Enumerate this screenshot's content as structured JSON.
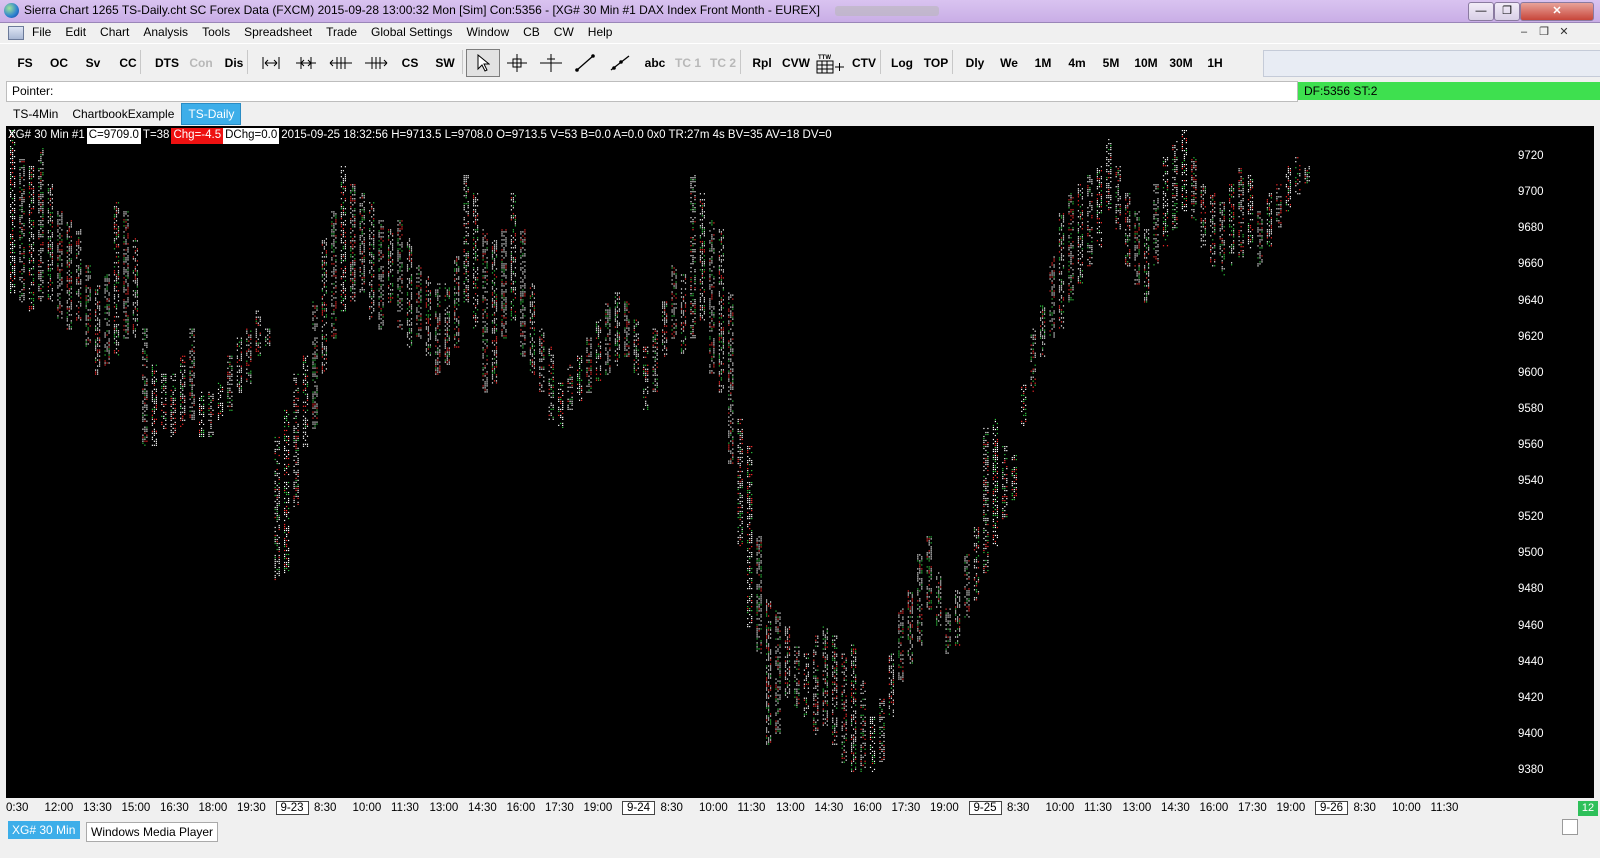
{
  "window": {
    "title": "Sierra Chart 1265 TS-Daily.cht  SC Forex Data (FXCM) 2015-09-28  13:00:32 Mon [Sim]  Con:5356 - [XG#  30 Min   #1  DAX Index Front Month - EUREX]",
    "minimize_label": "—",
    "restore_label": "❐",
    "close_label": "✕"
  },
  "menu": {
    "items": [
      "File",
      "Edit",
      "Chart",
      "Analysis",
      "Tools",
      "Spreadsheet",
      "Trade",
      "Global Settings",
      "Window",
      "CB",
      "CW",
      "Help"
    ],
    "mdi_min": "–",
    "mdi_restore": "❐",
    "mdi_close": "✕"
  },
  "toolbar": {
    "buttons": [
      {
        "label": "FS",
        "icon": "",
        "disabled": false,
        "active": false
      },
      {
        "label": "OC",
        "icon": "",
        "disabled": false,
        "active": false
      },
      {
        "label": "Sv",
        "icon": "",
        "disabled": false,
        "active": false
      },
      {
        "label": "CC",
        "icon": "",
        "disabled": false,
        "active": false
      },
      {
        "label": "DTS",
        "icon": "",
        "disabled": false,
        "active": false
      },
      {
        "label": "Con",
        "icon": "",
        "disabled": true,
        "active": false
      },
      {
        "label": "Dis",
        "icon": "",
        "disabled": false,
        "active": false
      },
      {
        "label": "",
        "icon": "zoom-in-horizontal-icon",
        "disabled": false,
        "active": false
      },
      {
        "label": "",
        "icon": "zoom-out-horizontal-icon",
        "disabled": false,
        "active": false
      },
      {
        "label": "",
        "icon": "scroll-left-icon",
        "disabled": false,
        "active": false
      },
      {
        "label": "",
        "icon": "scroll-right-icon",
        "disabled": false,
        "active": false
      },
      {
        "label": "CS",
        "icon": "",
        "disabled": false,
        "active": false
      },
      {
        "label": "SW",
        "icon": "",
        "disabled": false,
        "active": false
      },
      {
        "label": "",
        "icon": "pointer-arrow-icon",
        "disabled": false,
        "active": true
      },
      {
        "label": "",
        "icon": "crosshair-icon",
        "disabled": false,
        "active": false
      },
      {
        "label": "",
        "icon": "value-tool-icon",
        "disabled": false,
        "active": false
      },
      {
        "label": "",
        "icon": "line-tool-icon",
        "disabled": false,
        "active": false
      },
      {
        "label": "",
        "icon": "ray-tool-icon",
        "disabled": false,
        "active": false
      },
      {
        "label": "abc",
        "icon": "",
        "disabled": false,
        "active": false
      },
      {
        "label": "TC 1",
        "icon": "",
        "disabled": true,
        "active": false
      },
      {
        "label": "TC 2",
        "icon": "",
        "disabled": true,
        "active": false
      },
      {
        "label": "Rpl",
        "icon": "",
        "disabled": false,
        "active": false
      },
      {
        "label": "CVW",
        "icon": "",
        "disabled": false,
        "active": false
      },
      {
        "label": "",
        "icon": "trade-window-grid-icon",
        "disabled": false,
        "active": false
      },
      {
        "label": "CTV",
        "icon": "",
        "disabled": false,
        "active": false
      },
      {
        "label": "Log",
        "icon": "",
        "disabled": false,
        "active": false
      },
      {
        "label": "TOP",
        "icon": "",
        "disabled": false,
        "active": false
      },
      {
        "label": "Dly",
        "icon": "",
        "disabled": false,
        "active": false
      },
      {
        "label": "We",
        "icon": "",
        "disabled": false,
        "active": false
      },
      {
        "label": "1M",
        "icon": "",
        "disabled": false,
        "active": false
      },
      {
        "label": "4m",
        "icon": "",
        "disabled": false,
        "active": false
      },
      {
        "label": "5M",
        "icon": "",
        "disabled": false,
        "active": false
      },
      {
        "label": "10M",
        "icon": "",
        "disabled": false,
        "active": false
      },
      {
        "label": "30M",
        "icon": "",
        "disabled": false,
        "active": false
      },
      {
        "label": "1H",
        "icon": "",
        "disabled": false,
        "active": false
      }
    ]
  },
  "pointer_bar": {
    "label": "Pointer:",
    "status": "DF:5356  ST:2"
  },
  "tabs": [
    {
      "label": "TS-4Min",
      "active": false
    },
    {
      "label": "ChartbookExample",
      "active": false
    },
    {
      "label": "TS-Daily",
      "active": true
    }
  ],
  "info_bar": {
    "symbol": "XG#  30 Min   #1",
    "close": "C=9709.0",
    "trades": "T=38",
    "change": "Chg=-4.5",
    "daily_change": "DChg=0.0",
    "bar_details": "2015-09-25 18:32:56 H=9713.5 L=9708.0 O=9713.5 V=53 B=0.0 A=0.0 0x0 TR:27m 4s BV=35 AV=18 DV=0"
  },
  "colors": {
    "chart_bg": "#000000",
    "up_tick": "#2ecc40",
    "down_tick": "#ff2b2b",
    "neutral_tick": "#ffffff",
    "active_tab": "#3daee9",
    "status_green": "#3ee04f"
  },
  "chart_data": {
    "type": "line",
    "subtype": "tick-cluster-bars",
    "ylim": [
      9375,
      9735
    ],
    "yticks": [
      9380,
      9400,
      9420,
      9440,
      9460,
      9480,
      9500,
      9520,
      9540,
      9560,
      9580,
      9600,
      9620,
      9640,
      9660,
      9680,
      9700,
      9720
    ],
    "xticks": [
      {
        "label": "0:30",
        "date": false
      },
      {
        "label": "12:00",
        "date": false
      },
      {
        "label": "13:30",
        "date": false
      },
      {
        "label": "15:00",
        "date": false
      },
      {
        "label": "16:30",
        "date": false
      },
      {
        "label": "18:00",
        "date": false
      },
      {
        "label": "19:30",
        "date": false
      },
      {
        "label": "9-23",
        "date": true
      },
      {
        "label": "8:30",
        "date": false
      },
      {
        "label": "10:00",
        "date": false
      },
      {
        "label": "11:30",
        "date": false
      },
      {
        "label": "13:00",
        "date": false
      },
      {
        "label": "14:30",
        "date": false
      },
      {
        "label": "16:00",
        "date": false
      },
      {
        "label": "17:30",
        "date": false
      },
      {
        "label": "19:00",
        "date": false
      },
      {
        "label": "9-24",
        "date": true
      },
      {
        "label": "8:30",
        "date": false
      },
      {
        "label": "10:00",
        "date": false
      },
      {
        "label": "11:30",
        "date": false
      },
      {
        "label": "13:00",
        "date": false
      },
      {
        "label": "14:30",
        "date": false
      },
      {
        "label": "16:00",
        "date": false
      },
      {
        "label": "17:30",
        "date": false
      },
      {
        "label": "19:00",
        "date": false
      },
      {
        "label": "9-25",
        "date": true
      },
      {
        "label": "8:30",
        "date": false
      },
      {
        "label": "10:00",
        "date": false
      },
      {
        "label": "11:30",
        "date": false
      },
      {
        "label": "13:00",
        "date": false
      },
      {
        "label": "14:30",
        "date": false
      },
      {
        "label": "16:00",
        "date": false
      },
      {
        "label": "17:30",
        "date": false
      },
      {
        "label": "19:00",
        "date": false
      },
      {
        "label": "9-26",
        "date": true
      },
      {
        "label": "8:30",
        "date": false
      },
      {
        "label": "10:00",
        "date": false
      },
      {
        "label": "11:30",
        "date": false
      }
    ],
    "x_axis_end_label": "12",
    "series": [
      {
        "values": [
          [
            9645,
            9735
          ],
          [
            9640,
            9720
          ],
          [
            9635,
            9715
          ],
          [
            9640,
            9725
          ],
          [
            9640,
            9705
          ],
          [
            9630,
            9690
          ],
          [
            9625,
            9685
          ],
          [
            9630,
            9680
          ],
          [
            9615,
            9660
          ],
          [
            9600,
            9650
          ],
          [
            9605,
            9655
          ],
          [
            9610,
            9695
          ],
          [
            9620,
            9690
          ],
          [
            9620,
            9675
          ],
          [
            9560,
            9625
          ],
          [
            9560,
            9605
          ],
          [
            9570,
            9600
          ],
          [
            9565,
            9600
          ],
          [
            9570,
            9610
          ],
          [
            9575,
            9625
          ],
          [
            9565,
            9590
          ],
          [
            9565,
            9590
          ],
          [
            9575,
            9595
          ],
          [
            9580,
            9610
          ],
          [
            9590,
            9620
          ],
          [
            9595,
            9625
          ],
          [
            9610,
            9635
          ],
          [
            9615,
            9625
          ],
          [
            9485,
            9565
          ],
          [
            9490,
            9580
          ],
          [
            9525,
            9600
          ],
          [
            9560,
            9610
          ],
          [
            9570,
            9640
          ],
          [
            9600,
            9675
          ],
          [
            9620,
            9690
          ],
          [
            9635,
            9715
          ],
          [
            9640,
            9705
          ],
          [
            9645,
            9700
          ],
          [
            9630,
            9695
          ],
          [
            9625,
            9685
          ],
          [
            9640,
            9680
          ],
          [
            9625,
            9685
          ],
          [
            9615,
            9675
          ],
          [
            9620,
            9660
          ],
          [
            9610,
            9655
          ],
          [
            9600,
            9650
          ],
          [
            9605,
            9650
          ],
          [
            9615,
            9665
          ],
          [
            9640,
            9710
          ],
          [
            9625,
            9700
          ],
          [
            9590,
            9680
          ],
          [
            9595,
            9675
          ],
          [
            9620,
            9680
          ],
          [
            9630,
            9700
          ],
          [
            9610,
            9680
          ],
          [
            9600,
            9650
          ],
          [
            9590,
            9625
          ],
          [
            9575,
            9615
          ],
          [
            9570,
            9595
          ],
          [
            9580,
            9605
          ],
          [
            9585,
            9610
          ],
          [
            9590,
            9620
          ],
          [
            9595,
            9630
          ],
          [
            9600,
            9640
          ],
          [
            9605,
            9645
          ],
          [
            9610,
            9640
          ],
          [
            9600,
            9630
          ],
          [
            9580,
            9615
          ],
          [
            9590,
            9625
          ],
          [
            9610,
            9640
          ],
          [
            9620,
            9660
          ],
          [
            9610,
            9655
          ],
          [
            9620,
            9710
          ],
          [
            9630,
            9700
          ],
          [
            9600,
            9685
          ],
          [
            9590,
            9680
          ],
          [
            9550,
            9645
          ],
          [
            9505,
            9575
          ],
          [
            9460,
            9560
          ],
          [
            9445,
            9510
          ],
          [
            9395,
            9475
          ],
          [
            9400,
            9470
          ],
          [
            9420,
            9460
          ],
          [
            9415,
            9450
          ],
          [
            9410,
            9445
          ],
          [
            9400,
            9455
          ],
          [
            9405,
            9460
          ],
          [
            9395,
            9455
          ],
          [
            9385,
            9445
          ],
          [
            9380,
            9450
          ],
          [
            9380,
            9430
          ],
          [
            9380,
            9410
          ],
          [
            9385,
            9420
          ],
          [
            9410,
            9445
          ],
          [
            9430,
            9470
          ],
          [
            9440,
            9480
          ],
          [
            9450,
            9500
          ],
          [
            9470,
            9510
          ],
          [
            9460,
            9490
          ],
          [
            9445,
            9470
          ],
          [
            9450,
            9480
          ],
          [
            9465,
            9500
          ],
          [
            9475,
            9515
          ],
          [
            9490,
            9570
          ],
          [
            9505,
            9575
          ],
          [
            9520,
            9560
          ],
          [
            9530,
            9555
          ],
          [
            9570,
            9595
          ],
          [
            9590,
            9625
          ],
          [
            9610,
            9640
          ],
          [
            9620,
            9665
          ],
          [
            9625,
            9690
          ],
          [
            9640,
            9700
          ],
          [
            9650,
            9705
          ],
          [
            9660,
            9710
          ],
          [
            9670,
            9715
          ],
          [
            9690,
            9730
          ],
          [
            9680,
            9715
          ],
          [
            9660,
            9700
          ],
          [
            9650,
            9690
          ],
          [
            9640,
            9680
          ],
          [
            9660,
            9705
          ],
          [
            9670,
            9720
          ],
          [
            9680,
            9730
          ],
          [
            9690,
            9735
          ],
          [
            9685,
            9720
          ],
          [
            9670,
            9705
          ],
          [
            9660,
            9700
          ],
          [
            9655,
            9695
          ],
          [
            9660,
            9705
          ],
          [
            9665,
            9715
          ],
          [
            9670,
            9710
          ],
          [
            9660,
            9690
          ],
          [
            9670,
            9700
          ],
          [
            9680,
            9705
          ],
          [
            9690,
            9715
          ],
          [
            9700,
            9720
          ],
          [
            9705,
            9715
          ]
        ]
      }
    ]
  },
  "bottom": {
    "chip": "XG#  30 Min",
    "next": "Windows Media Player"
  }
}
